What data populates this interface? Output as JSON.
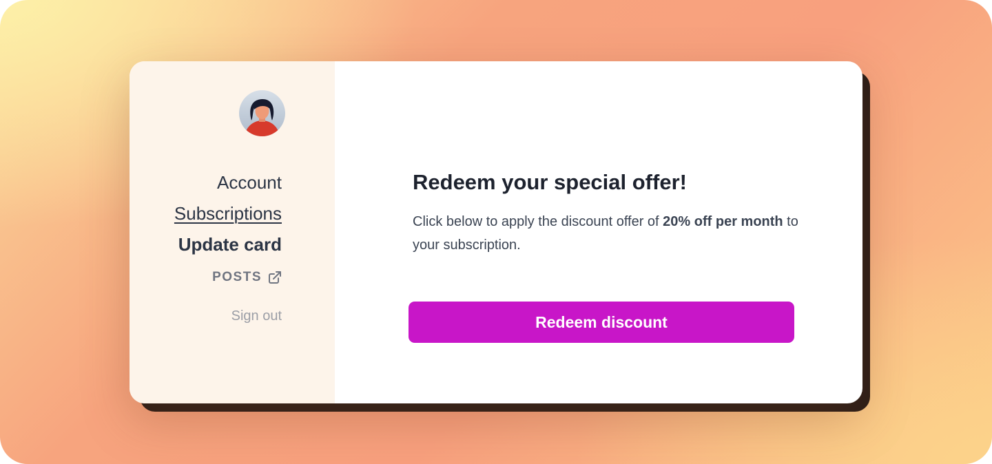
{
  "sidebar": {
    "avatar_icon": "user-avatar-icon",
    "nav": {
      "account": "Account",
      "subscriptions": "Subscriptions",
      "update_card": "Update card",
      "posts": "POSTS",
      "posts_icon": "external-link-icon",
      "sign_out": "Sign out"
    }
  },
  "offer": {
    "title": "Redeem your special offer!",
    "desc_prefix": "Click below to apply the discount offer of ",
    "desc_bold": "20% off per month",
    "desc_suffix": " to your subscription.",
    "button_label": "Redeem discount"
  },
  "colors": {
    "accent": "#c816c8",
    "sidebar_bg": "#fdf4ea",
    "text_dark": "#2b3444",
    "text_muted": "#9b9ea6",
    "card_shadow": "#2a1d18"
  }
}
